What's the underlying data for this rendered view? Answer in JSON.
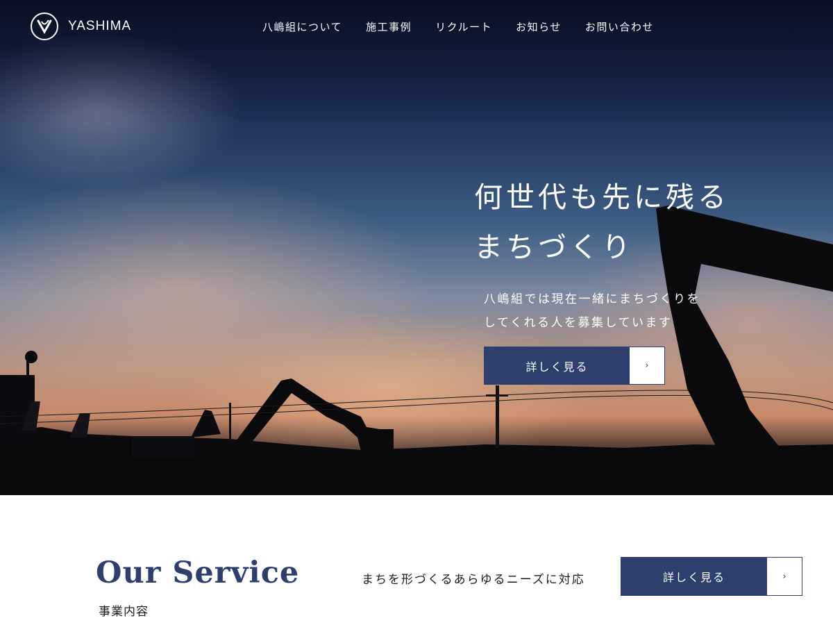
{
  "header": {
    "logo_text": "YASHIMA",
    "nav": [
      {
        "label": "八嶋組について"
      },
      {
        "label": "施工事例"
      },
      {
        "label": "リクルート"
      },
      {
        "label": "お知らせ"
      },
      {
        "label": "お問い合わせ"
      }
    ]
  },
  "hero": {
    "title_line1": "何世代も先に残る",
    "title_line2": "まちづくり",
    "sub_line1": "八嶋組では現在一緒にまちづくりを",
    "sub_line2": "してくれる人を募集しています",
    "button_label": "詳しく見る",
    "button_arrow": "›"
  },
  "service": {
    "title": "Our Service",
    "subtitle": "事業内容",
    "description": "まちを形づくるあらゆるニーズに対応",
    "button_label": "詳しく見る",
    "button_arrow": "›"
  },
  "colors": {
    "navy": "#2e3f6e",
    "white": "#ffffff"
  },
  "icons": {
    "logo": "yashima-logo-icon",
    "arrow": "chevron-right-icon"
  }
}
